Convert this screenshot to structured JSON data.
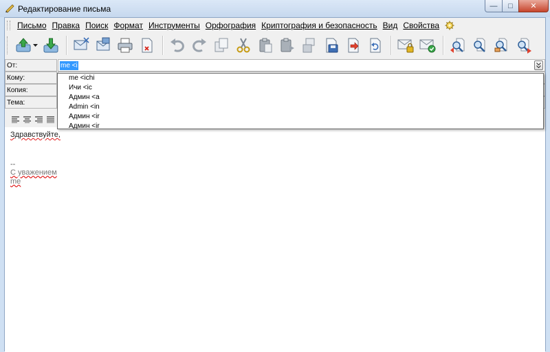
{
  "window": {
    "title": "Редактирование письма",
    "min_glyph": "—",
    "max_glyph": "□",
    "close_glyph": "✕"
  },
  "menu": [
    {
      "label": "Письмо"
    },
    {
      "label": "Правка"
    },
    {
      "label": "Поиск"
    },
    {
      "label": "Формат"
    },
    {
      "label": "Инструменты"
    },
    {
      "label": "Орфография"
    },
    {
      "label": "Криптография и безопасность"
    },
    {
      "label": "Вид"
    },
    {
      "label": "Свойства"
    }
  ],
  "headers": {
    "from_label": "От:",
    "from_value": "me <i",
    "to_label": "Кому:",
    "cc_label": "Копия:",
    "subject_label": "Тема:"
  },
  "autocomplete": [
    "me <ichi",
    "Ичи <ic",
    "Админ <a",
    "Admin <in",
    "Админ <ir",
    "Админ <ir"
  ],
  "body": {
    "greeting": "Здравствуйте,",
    "dash": "--",
    "regards": "С уважением",
    "signature": "me"
  },
  "icons": [
    "send-icon",
    "save-icon",
    "address-book-icon",
    "attach-icon",
    "print-icon",
    "delete-icon",
    "undo-icon",
    "redo-icon",
    "copy-icon",
    "cut-icon",
    "paste-icon",
    "paste-special-icon",
    "insert-icon",
    "save-draft-icon",
    "forward-icon",
    "reply-icon",
    "encrypt-icon",
    "sign-icon",
    "find-prev-icon",
    "find-icon",
    "find-next-icon",
    "replace-icon"
  ],
  "colors": {
    "accent": "#3399ff",
    "titlebar": "#c6d8ee",
    "spell_error": "#e01818"
  }
}
